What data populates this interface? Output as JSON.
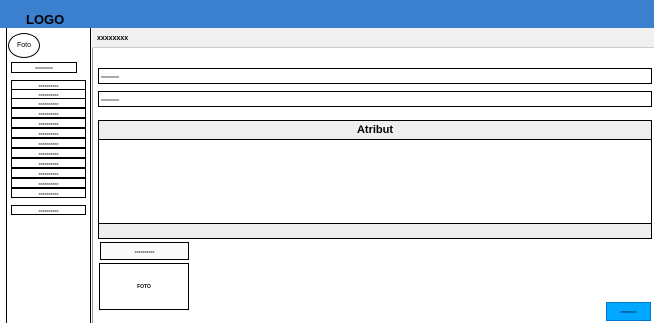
{
  "header": {
    "logo": "LOGO"
  },
  "sidebar": {
    "avatar_label": "Foto",
    "first_label": "xxxxxxxxx",
    "items": [
      {
        "label": "xxxxxxxxxx"
      },
      {
        "label": "xxxxxxxxxx"
      },
      {
        "label": "xxxxxxxxxx"
      },
      {
        "label": "xxxxxxxxxx"
      },
      {
        "label": "xxxxxxxxxx"
      },
      {
        "label": "xxxxxxxxxx"
      },
      {
        "label": "xxxxxxxxxx"
      },
      {
        "label": "xxxxxxxxxx"
      },
      {
        "label": "xxxxxxxxxx"
      },
      {
        "label": "xxxxxxxxxx"
      },
      {
        "label": "xxxxxxxxxx"
      },
      {
        "label": "xxxxxxxxxx"
      },
      {
        "label": "xxxxxxxxxx"
      }
    ]
  },
  "main": {
    "title": "xxxxxxxx",
    "field1": "xxxxxxxxx",
    "field2": "xxxxxxxxx",
    "atribut_title": "Atribut",
    "small_button": "xxxxxxxxxx",
    "photo_label": "FOTO",
    "action_button": "xxxxxxxx"
  },
  "colors": {
    "topbar": "#3b7fcf",
    "action_button": "#00a8ff"
  }
}
